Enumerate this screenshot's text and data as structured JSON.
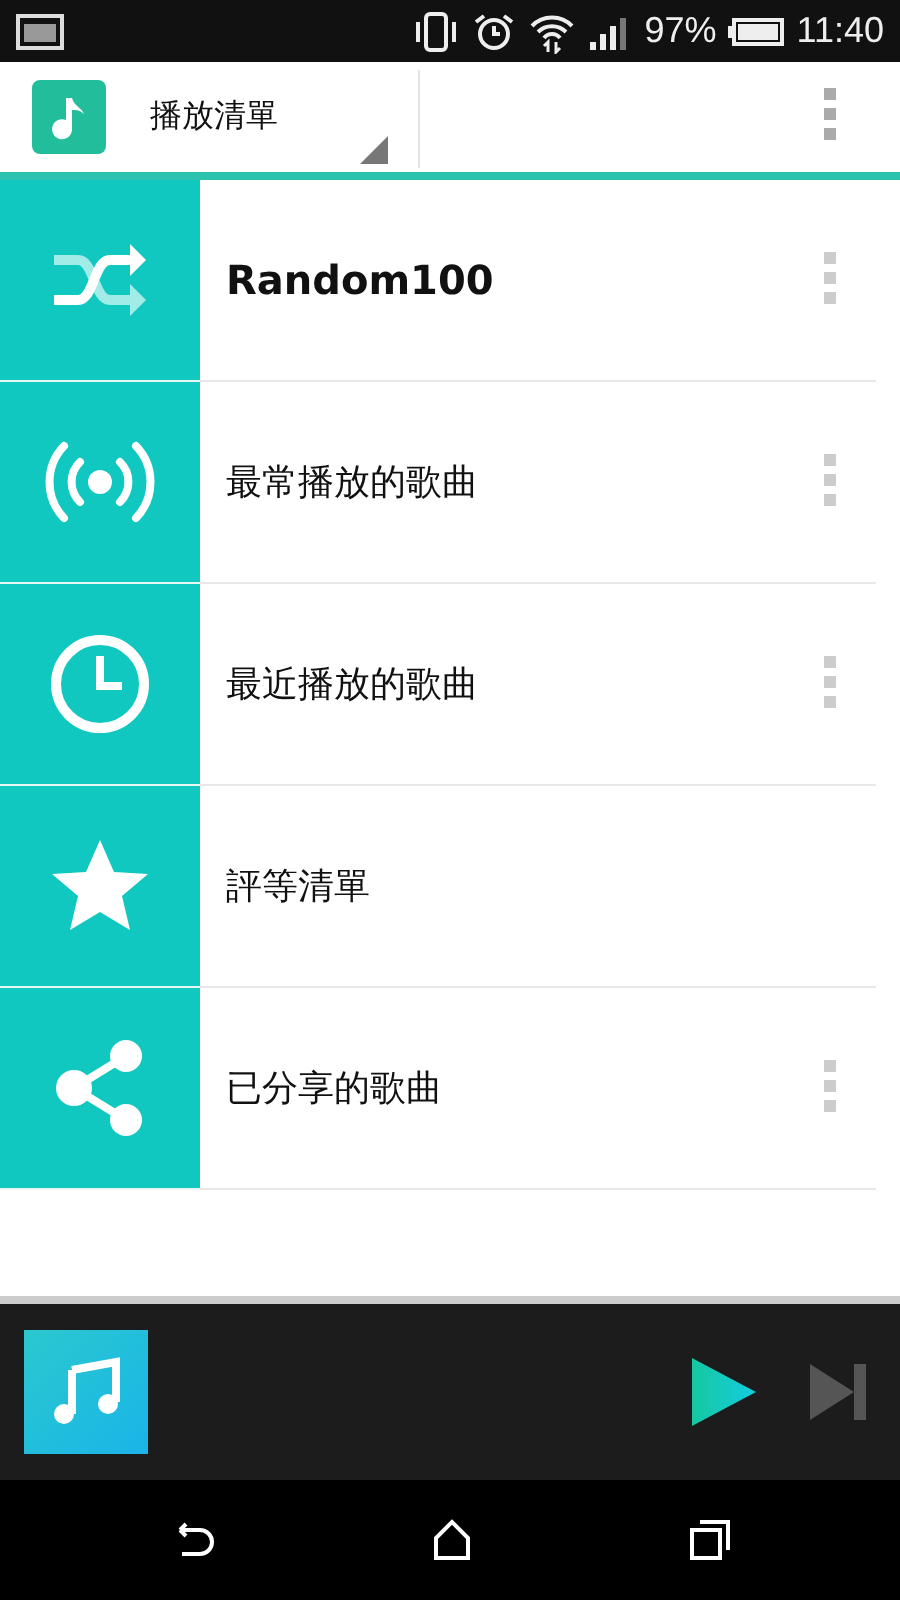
{
  "status_bar": {
    "battery": "97%",
    "time": "11:40"
  },
  "header": {
    "title": "播放清單"
  },
  "playlists": [
    {
      "kind": "shuffle",
      "title": "Random100",
      "emphasized": true,
      "has_menu": true
    },
    {
      "kind": "broadcast",
      "title": "最常播放的歌曲",
      "emphasized": false,
      "has_menu": true
    },
    {
      "kind": "clock",
      "title": "最近播放的歌曲",
      "emphasized": false,
      "has_menu": true
    },
    {
      "kind": "star",
      "title": "評等清單",
      "emphasized": false,
      "has_menu": false
    },
    {
      "kind": "share",
      "title": "已分享的歌曲",
      "emphasized": false,
      "has_menu": true
    }
  ]
}
